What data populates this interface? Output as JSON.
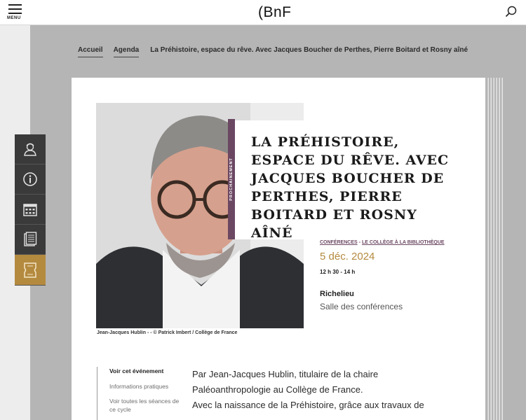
{
  "header": {
    "menu_label": "MENU",
    "logo": "(BnF"
  },
  "breadcrumb": {
    "items": [
      "Accueil",
      "Agenda"
    ],
    "current": "La Préhistoire, espace du rêve. Avec Jacques Boucher de Perthes, Pierre Boitard et Rosny aîné"
  },
  "side_tools": [
    "person-icon",
    "info-icon",
    "calendar-icon",
    "document-icon",
    "ticket-icon"
  ],
  "event": {
    "ribbon": "PROCHAINEMENT",
    "title": "LA PRÉHISTOIRE, ESPACE DU RÊVE. AVEC JACQUES BOUCHER DE PERTHES, PIERRE BOITARD ET ROSNY AÎNÉ",
    "tag1": "CONFÉRENCES",
    "tag_sep": "-",
    "tag2": "LE COLLÈGE À LA BIBLIOTHÈQUE",
    "date": "5 déc. 2024",
    "time": "12 h 30 - 14 h",
    "place": "Richelieu",
    "room": "Salle des conférences",
    "photo_caption": "Jean-Jacques Hublin - - © Patrick Imbert / Collège de France"
  },
  "subnav": [
    "Voir cet événement",
    "Informations pratiques",
    "Voir toutes les séances de ce cycle"
  ],
  "body": [
    "Par Jean-Jacques Hublin, titulaire de la chaire",
    "Paléoanthropologie au Collège de France.",
    "Avec la naissance de la Préhistoire, grâce aux travaux de"
  ],
  "colors": {
    "accent_purple": "#6b4762",
    "accent_gold": "#b48a3f",
    "tool_dark": "#3a3a3a"
  }
}
